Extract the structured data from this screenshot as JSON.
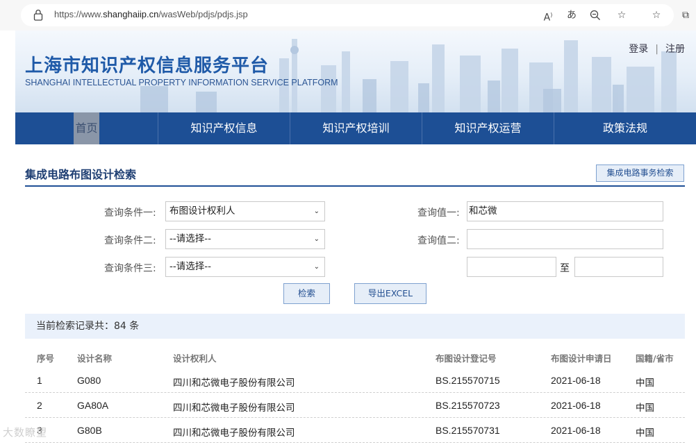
{
  "browser": {
    "url_prefix": "https://www.",
    "url_domain": "shanghaiip.cn",
    "url_path": "/wasWeb/pdjs/pdjs.jsp",
    "icons": [
      "read-aloud-icon",
      "translate-icon",
      "zoom-icon",
      "add-favorite-icon",
      "favorites-icon",
      "collections-icon"
    ]
  },
  "header": {
    "title_cn": "上海市知识产权信息服务平台",
    "title_en": "SHANGHAI INTELLECTUAL PROPERTY INFORMATION SERVICE PLATFORM",
    "login": "登录",
    "separator": "|",
    "register": "注册"
  },
  "nav": {
    "items": [
      "首页",
      "知识产权信息",
      "知识产权培训",
      "知识产权运营",
      "政策法规"
    ]
  },
  "section": {
    "title": "集成电路布图设计检索",
    "side_button": "集成电路事务检索"
  },
  "form": {
    "cond1_label": "查询条件一:",
    "cond1_value": "布图设计权利人",
    "cond2_label": "查询条件二:",
    "cond2_value": "--请选择--",
    "cond3_label": "查询条件三:",
    "cond3_value": "--请选择--",
    "val1_label": "查询值一:",
    "val1_value": "和芯微",
    "val2_label": "查询值二:",
    "val2_value": "",
    "range_from": "",
    "range_sep": "至",
    "range_to": "",
    "search_button": "检索",
    "export_button": "导出EXCEL"
  },
  "summary": {
    "text": "当前检索记录共：84 条"
  },
  "table": {
    "headers": [
      "序号",
      "设计名称",
      "设计权利人",
      "布图设计登记号",
      "布图设计申请日",
      "国籍/省市"
    ],
    "rows": [
      [
        "1",
        "G080",
        "四川和芯微电子股份有限公司",
        "BS.215570715",
        "2021-06-18",
        "中国"
      ],
      [
        "2",
        "GA80A",
        "四川和芯微电子股份有限公司",
        "BS.215570723",
        "2021-06-18",
        "中国"
      ],
      [
        "3",
        "G80B",
        "四川和芯微电子股份有限公司",
        "BS.215570731",
        "2021-06-18",
        "中国"
      ]
    ]
  },
  "watermark": "大数瞭望",
  "colors": {
    "nav_bg": "#1d4f95",
    "title_blue": "#1f5aa8",
    "summary_bg": "#eaf1fb",
    "button_bg": "#e6eef8"
  }
}
